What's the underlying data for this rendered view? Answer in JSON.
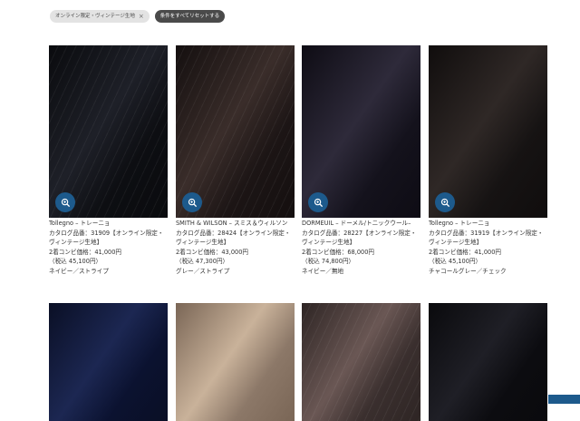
{
  "filters": {
    "active_chip": "オンライン限定・ヴィンテージ生地",
    "reset_label": "条件をすべてリセットする"
  },
  "products": [
    {
      "name": "Tollegno – トレーニョ",
      "catalog": "カタログ品番：31909【オンライン限定・ヴィンテージ生地】",
      "price": "2着コンビ価格：41,000円",
      "tax": "（税込 45,100円）",
      "color": "ネイビー／ストライプ",
      "swatch": [
        "#0d0e12",
        "#1e2028",
        "#0a0b0e"
      ]
    },
    {
      "name": "SMITH & WILSON – スミス＆ウィルソン",
      "catalog": "カタログ品番：28424【オンライン限定・ヴィンテージ生地】",
      "price": "2着コンビ価格：43,000円",
      "tax": "（税込 47,300円）",
      "color": "グレー／ストライプ",
      "swatch": [
        "#1c1515",
        "#3a2d2a",
        "#140f0f"
      ]
    },
    {
      "name": "DORMEUIL – ドーメル/トニックウール–",
      "catalog": "カタログ品番：28227【オンライン限定・ヴィンテージ生地】",
      "price": "2着コンビ価格：68,000円",
      "tax": "（税込 74,800円）",
      "color": "ネイビー／無地",
      "swatch": [
        "#14121c",
        "#2e2a3a",
        "#0e0c14"
      ]
    },
    {
      "name": "Tollegno – トレーニョ",
      "catalog": "カタログ品番：31919【オンライン限定・ヴィンテージ生地】",
      "price": "2着コンビ価格：41,000円",
      "tax": "（税込 45,100円）",
      "color": "チャコールグレー／チェック",
      "swatch": [
        "#161313",
        "#2f2826",
        "#100d0d"
      ]
    }
  ],
  "bottom_swatches": [
    [
      "#0b1230",
      "#1c2752",
      "#0a0f25"
    ],
    [
      "#8c7868",
      "#c9b29a",
      "#7a6656"
    ],
    [
      "#3a2f2e",
      "#6a5754",
      "#2e2524"
    ],
    [
      "#0c0c10",
      "#1f1f26",
      "#0a0a0d"
    ]
  ]
}
